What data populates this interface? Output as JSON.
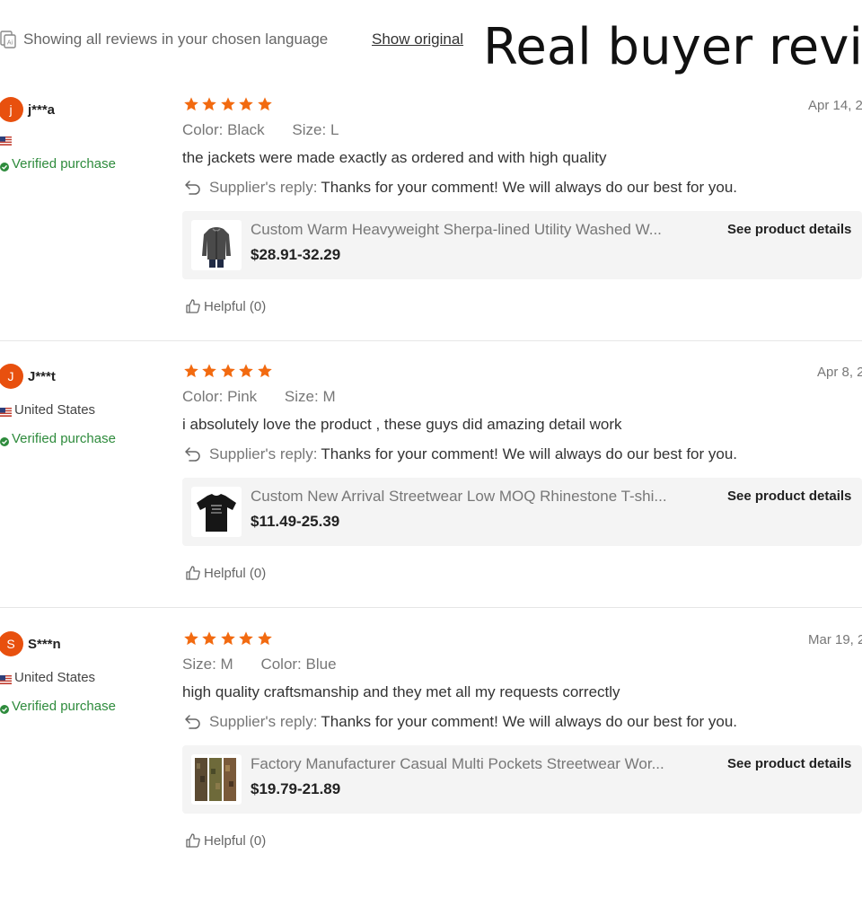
{
  "header": {
    "language_text": "Showing all reviews in your chosen language",
    "show_original": "Show original",
    "title": "Real buyer revie"
  },
  "colors": {
    "accent": "#e8500e",
    "star": "#f26a10",
    "verified": "#2e8b3c"
  },
  "reviews": [
    {
      "avatar_letter": "j",
      "username": "j***a",
      "country": "",
      "verified": "Verified purchase",
      "rating": 5,
      "date": "Apr 14, 2",
      "attrs": [
        {
          "label": "Color:",
          "value": "Black"
        },
        {
          "label": "Size:",
          "value": "L"
        }
      ],
      "comment": "the jackets were made exactly as ordered and with high quality",
      "reply_label": "Supplier's reply:",
      "reply_text": "Thanks for your comment! We will always do our best for you.",
      "product": {
        "title": "Custom Warm Heavyweight Sherpa-lined Utility Washed W...",
        "price": "$28.91-32.29",
        "thumb_icon": "jacket-image",
        "details": "See product details"
      },
      "helpful": "Helpful (0)"
    },
    {
      "avatar_letter": "J",
      "username": "J***t",
      "country": "United States",
      "verified": "Verified purchase",
      "rating": 5,
      "date": "Apr 8, 2",
      "attrs": [
        {
          "label": "Color:",
          "value": "Pink"
        },
        {
          "label": "Size:",
          "value": "M"
        }
      ],
      "comment": "i absolutely love the product , these guys did amazing detail work",
      "reply_label": "Supplier's reply:",
      "reply_text": "Thanks for your comment! We will always do our best for you.",
      "product": {
        "title": "Custom New Arrival Streetwear Low MOQ Rhinestone T-shi...",
        "price": "$11.49-25.39",
        "thumb_icon": "tshirt-image",
        "details": "See product details"
      },
      "helpful": "Helpful (0)"
    },
    {
      "avatar_letter": "S",
      "username": "S***n",
      "country": "United States",
      "verified": "Verified purchase",
      "rating": 5,
      "date": "Mar 19, 2",
      "attrs": [
        {
          "label": "Size:",
          "value": "M"
        },
        {
          "label": "Color:",
          "value": "Blue"
        }
      ],
      "comment": "high quality craftsmanship and they met all my requests correctly",
      "reply_label": "Supplier's reply:",
      "reply_text": "Thanks for your comment! We will always do our best for you.",
      "product": {
        "title": "Factory Manufacturer Casual Multi Pockets Streetwear Wor...",
        "price": "$19.79-21.89",
        "thumb_icon": "pants-image",
        "details": "See product details"
      },
      "helpful": "Helpful (0)"
    }
  ]
}
